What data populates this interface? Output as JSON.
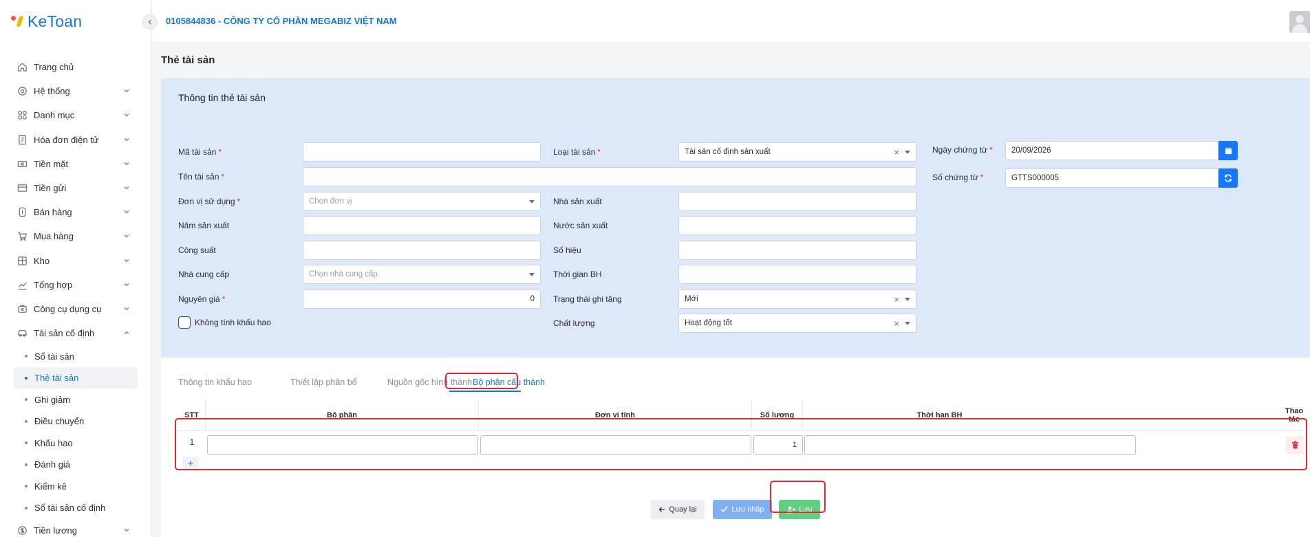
{
  "app": {
    "logo_text": "KeToan"
  },
  "header": {
    "company": "0105844836 - CÔNG TY CỔ PHẦN MEGABIZ VIỆT NAM"
  },
  "sidebar": {
    "items": [
      {
        "label": "Trang chủ",
        "icon": "home-icon"
      },
      {
        "label": "Hệ thống",
        "icon": "gear-icon"
      },
      {
        "label": "Danh mục",
        "icon": "grid-icon"
      },
      {
        "label": "Hóa đơn điện tử",
        "icon": "invoice-icon"
      },
      {
        "label": "Tiền mặt",
        "icon": "cash-icon"
      },
      {
        "label": "Tiền gửi",
        "icon": "bank-icon"
      },
      {
        "label": "Bán hàng",
        "icon": "sales-icon"
      },
      {
        "label": "Mua hàng",
        "icon": "cart-icon"
      },
      {
        "label": "Kho",
        "icon": "warehouse-icon"
      },
      {
        "label": "Tổng hợp",
        "icon": "chart-icon"
      },
      {
        "label": "Công cụ dụng cụ",
        "icon": "tools-icon"
      },
      {
        "label": "Tài sản cố định",
        "icon": "car-icon"
      }
    ],
    "sub_items": [
      "Sổ tài sản",
      "Thẻ tài sản",
      "Ghi giảm",
      "Điều chuyển",
      "Khấu hao",
      "Đánh giá",
      "Kiểm kê",
      "Sổ tài sản cố định"
    ],
    "active_sub": "Thẻ tài sản",
    "last_item": {
      "label": "Tiền lương",
      "icon": "salary-icon"
    }
  },
  "page": {
    "title": "Thẻ tài sản"
  },
  "form": {
    "section_title": "Thông tin thẻ tài sản",
    "ma_tai_san": {
      "label": "Mã tài sản",
      "value": ""
    },
    "ten_tai_san": {
      "label": "Tên tài sản",
      "value": ""
    },
    "don_vi_su_dung": {
      "label": "Đơn vị sử dụng",
      "placeholder": "Chọn đơn vị"
    },
    "nam_san_xuat": {
      "label": "Năm sản xuất",
      "value": ""
    },
    "cong_suat": {
      "label": "Công suất",
      "value": ""
    },
    "nha_cung_cap": {
      "label": "Nhà cung cấp",
      "placeholder": "Chọn nhà cung cấp"
    },
    "nguyen_gia": {
      "label": "Nguyên giá",
      "value": "0"
    },
    "khong_tinh_khau_hao": {
      "label": "Không tính khấu hao",
      "checked": false
    },
    "loai_tai_san": {
      "label": "Loại tài sản",
      "value": "Tài sản cố định sản xuất"
    },
    "nha_san_xuat": {
      "label": "Nhà sản xuất",
      "value": ""
    },
    "nuoc_san_xuat": {
      "label": "Nước sản xuất",
      "value": ""
    },
    "so_hieu": {
      "label": "Số hiệu",
      "value": ""
    },
    "thoi_gian_bh": {
      "label": "Thời gian BH",
      "value": ""
    },
    "trang_thai_ghi_tang": {
      "label": "Trạng thái ghi tăng",
      "value": "Mới"
    },
    "chat_luong": {
      "label": "Chất lượng",
      "value": "Hoạt động tốt"
    },
    "ngay_chung_tu": {
      "label": "Ngày chứng từ",
      "value": "20/09/2026"
    },
    "so_chung_tu": {
      "label": "Số chứng từ",
      "value": "GTTS000005"
    }
  },
  "tabs": [
    {
      "label": "Thông tin khấu hao"
    },
    {
      "label": "Thiết lập phân bổ"
    },
    {
      "label": "Nguồn gốc hình thành"
    },
    {
      "label": "Bộ phận cấu thành"
    }
  ],
  "active_tab": "Bộ phận cấu thành",
  "table": {
    "headers": {
      "stt": "STT",
      "bo_phan": "Bộ phận",
      "don_vi_tinh": "Đơn vị tính",
      "so_luong": "Số lượng",
      "thoi_han_bh": "Thời hạn BH",
      "thao_tac_1": "Thao",
      "thao_tac_2": "tác"
    },
    "rows": [
      {
        "stt": "1",
        "bo_phan": "",
        "don_vi_tinh": "",
        "so_luong": "1",
        "thoi_han_bh": ""
      }
    ],
    "add_symbol": "+"
  },
  "buttons": {
    "back": "Quay lại",
    "draft": "Lưu nháp",
    "save": "Lưu"
  },
  "colors": {
    "primary": "#1677d2",
    "panel": "#dde8f9",
    "save": "#5fcf84",
    "draft": "#7fb0f0",
    "highlight": "#e5282d"
  }
}
